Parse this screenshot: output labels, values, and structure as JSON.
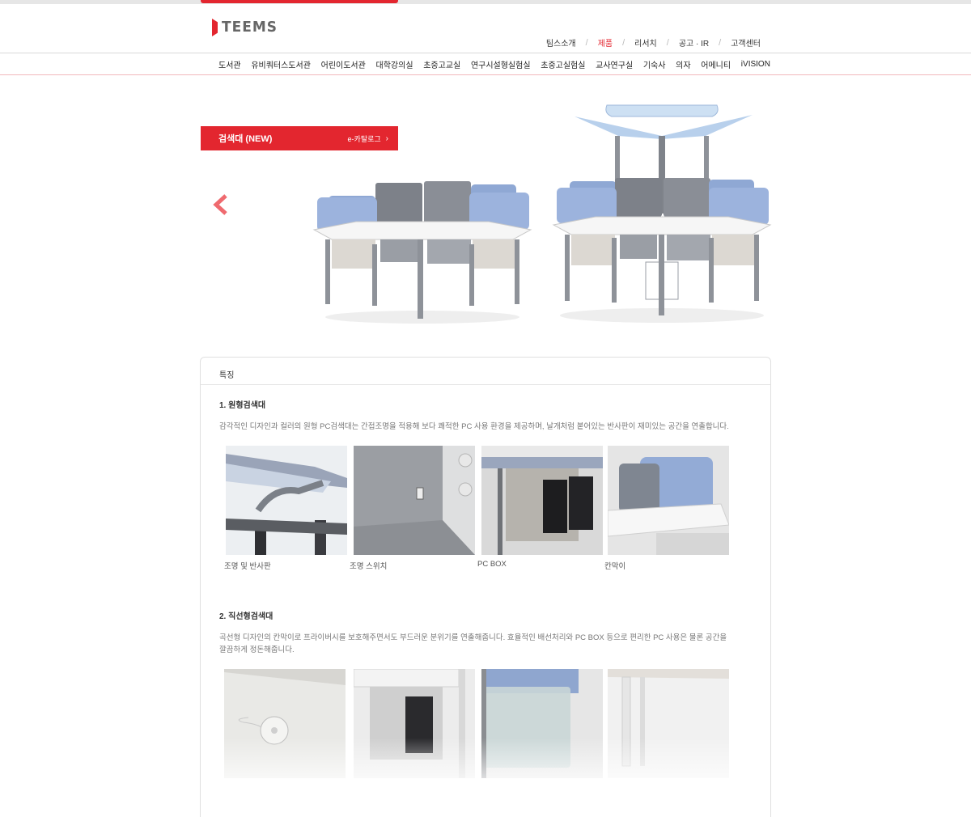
{
  "header": {
    "logo_text": "TEEMS",
    "util_nav": [
      "팀스소개",
      "제품",
      "리서치",
      "공고 · IR",
      "고객센터"
    ],
    "util_active": "제품",
    "gnb": [
      "도서관",
      "유비쿼터스도서관",
      "어린이도서관",
      "대학강의실",
      "초중고교실",
      "연구시설형실험실",
      "초중고실험실",
      "교사연구실",
      "기숙사",
      "의자",
      "어메니티",
      "iVISION"
    ]
  },
  "hero": {
    "title": "검색대 (NEW)",
    "catalog_label": "e-카탈로그",
    "catalog_icon": "chevron-right-icon",
    "prev_icon": "chevron-left-icon",
    "next_icon": "chevron-right-icon",
    "accent": "#e3262f"
  },
  "features": {
    "heading": "특징",
    "sections": [
      {
        "title": "1. 원형검색대",
        "description": "감각적인 디자인과 컬러의 원형 PC검색대는 간접조명을 적용해 보다 쾌적한 PC 사용 환경을 제공하며, 날개처럼 붙어있는 반사판이 재미있는 공간을 연출합니다.",
        "items": [
          "조명 및 반사판",
          "조명 스위치",
          "PC BOX",
          "칸막이"
        ]
      },
      {
        "title": "2. 직선형검색대",
        "description_lines": [
          "곡선형 디자인의 칸막이로 프라이버시를 보호해주면서도 부드러운 분위기를 연출해줍니다. 효율적인 배선처리와 PC BOX 등으로 편리한 PC 사용은 물론 공간을",
          "깔끔하게 정돈해줍니다."
        ]
      }
    ]
  }
}
